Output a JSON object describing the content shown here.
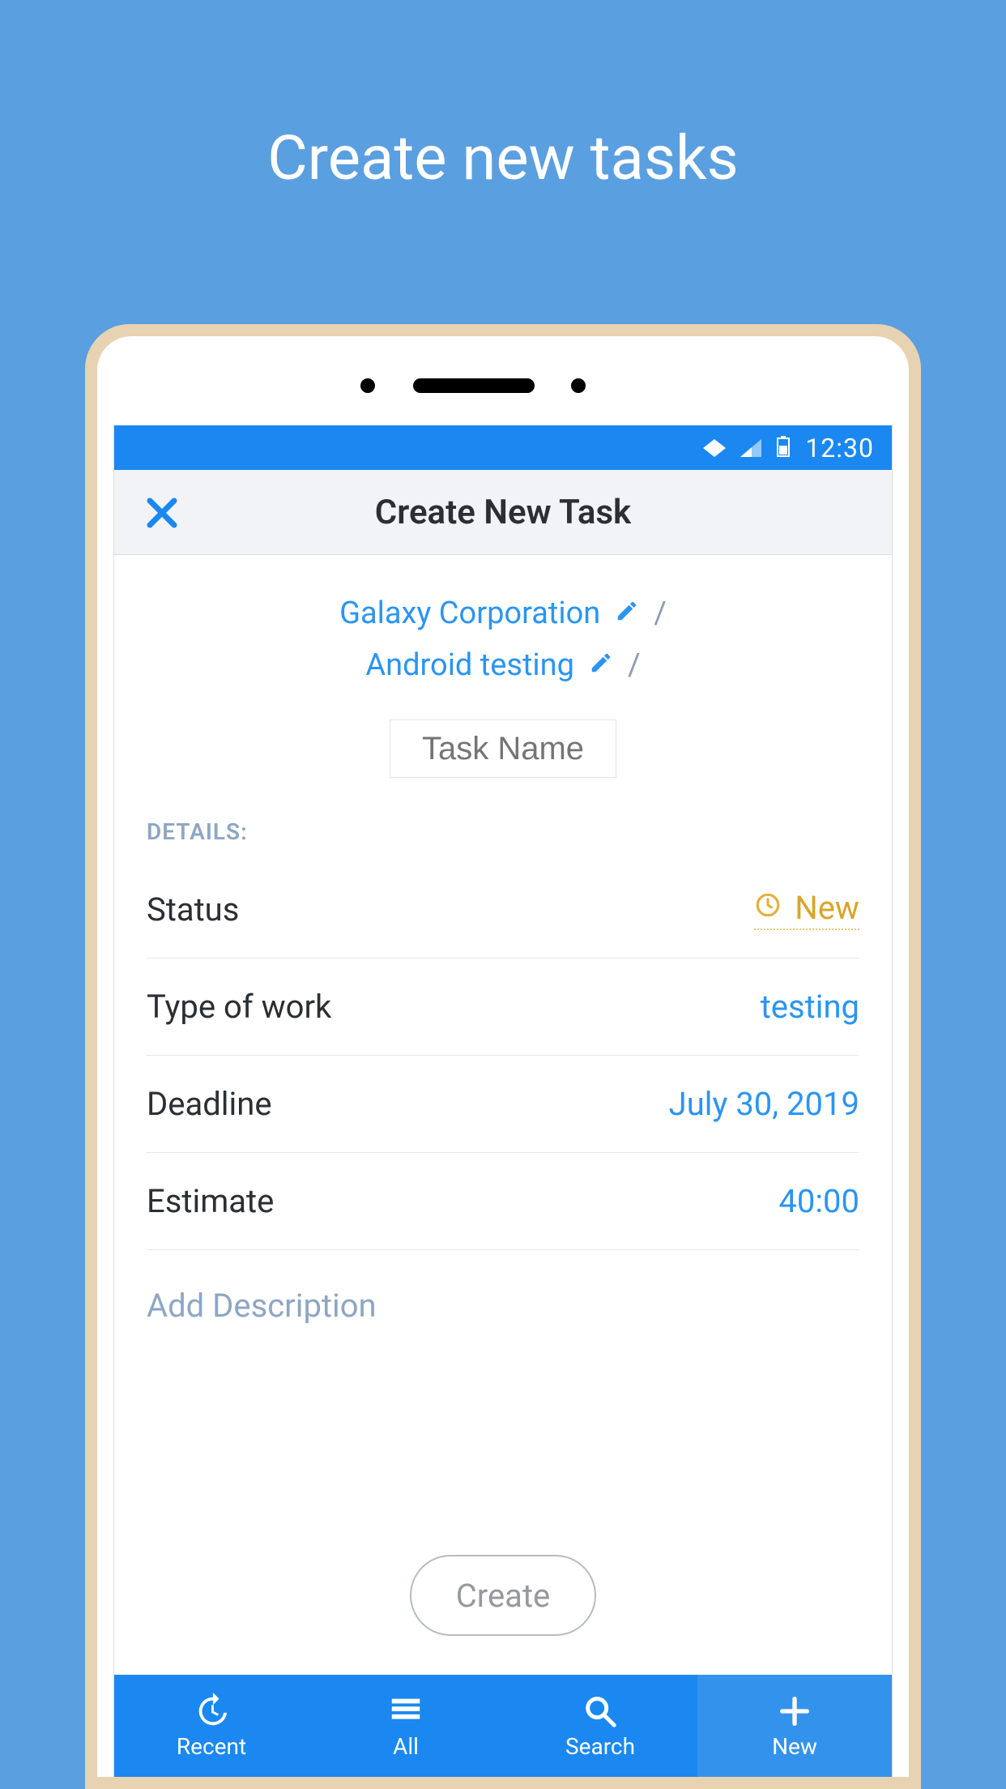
{
  "promo_title": "Create new tasks",
  "statusbar": {
    "time": "12:30"
  },
  "header": {
    "title": "Create New Task"
  },
  "breadcrumbs": {
    "org": "Galaxy Corporation",
    "project": "Android testing",
    "task_name_placeholder": "Task Name"
  },
  "details": {
    "section_label": "DETAILS:",
    "rows": {
      "status": {
        "label": "Status",
        "value": "New"
      },
      "type": {
        "label": "Type of work",
        "value": "testing"
      },
      "deadline": {
        "label": "Deadline",
        "value": "July 30, 2019"
      },
      "estimate": {
        "label": "Estimate",
        "value": "40:00"
      }
    },
    "add_description": "Add Description"
  },
  "create_button": "Create",
  "bottom_nav": {
    "recent": "Recent",
    "all": "All",
    "search": "Search",
    "new": "New"
  }
}
